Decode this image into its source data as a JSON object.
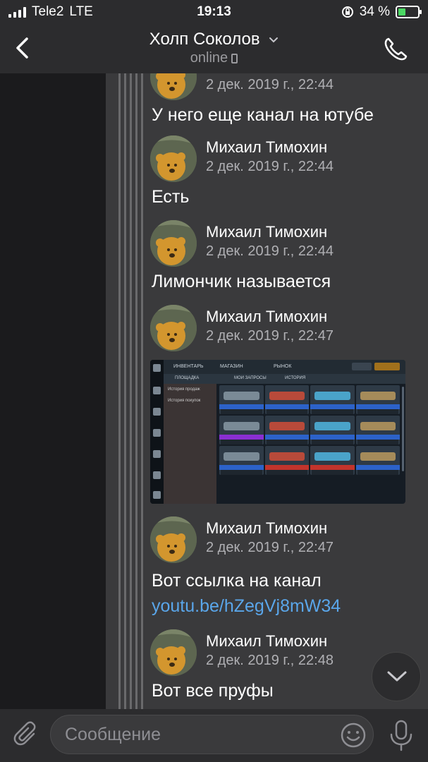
{
  "status_bar": {
    "carrier": "Tele2",
    "network": "LTE",
    "time": "19:13",
    "battery": "34 %"
  },
  "header": {
    "title": "Холп Соколов",
    "status": "online"
  },
  "messages": [
    {
      "author": "",
      "date": "2 дек. 2019 г., 22:44",
      "text": "У него еще канал на ютубе"
    },
    {
      "author": "Михаил Тимохин",
      "date": "2 дек. 2019 г., 22:44",
      "text": "Есть"
    },
    {
      "author": "Михаил Тимохин",
      "date": "2 дек. 2019 г., 22:44",
      "text": "Лимончик называется"
    },
    {
      "author": "Михаил Тимохин",
      "date": "2 дек. 2019 г., 22:47",
      "text": ""
    },
    {
      "author": "Михаил Тимохин",
      "date": "2 дек. 2019 г., 22:47",
      "text": "Вот ссылка на канал",
      "link": "youtu.be/hZegVj8mW34"
    },
    {
      "author": "Михаил Тимохин",
      "date": "2 дек. 2019 г., 22:48",
      "text": "Вот все пруфы"
    }
  ],
  "screenshot": {
    "tabs": [
      "ИНВЕНТАРЬ",
      "МАГАЗИН",
      "РЫНОК"
    ],
    "subtabs": [
      "ПЛОЩАДКА",
      "МОИ ЗАПРОСЫ",
      "ИСТОРИЯ"
    ],
    "history": [
      "История продаж",
      "История покупок"
    ],
    "cell_colors": [
      "#2c62c9",
      "#2c62c9",
      "#2c62c9",
      "#2c62c9",
      "#8a2fd1",
      "#2c62c9",
      "#2c62c9",
      "#2c62c9",
      "#2c62c9",
      "#c2342c",
      "#c2342c",
      "#2c62c9"
    ]
  },
  "composer": {
    "placeholder": "Сообщение"
  },
  "icons": {
    "back": "chevron-left-icon",
    "call": "phone-icon",
    "attach": "paperclip-icon",
    "emoji": "emoji-icon",
    "mic": "microphone-icon",
    "scroll": "chevron-down-icon"
  }
}
